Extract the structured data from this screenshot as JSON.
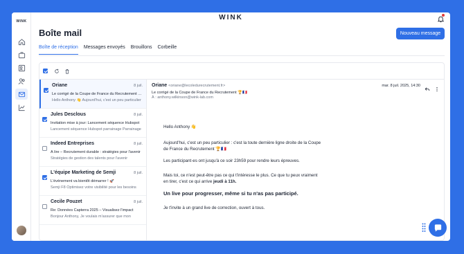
{
  "app": {
    "logo": "WINK",
    "side_logo": "WINK"
  },
  "header": {
    "title": "Boîte mail",
    "new_button": "Nouveau message"
  },
  "tabs": [
    {
      "label": "Boîte de réception",
      "active": true
    },
    {
      "label": "Messages envoyés",
      "active": false
    },
    {
      "label": "Brouillons",
      "active": false
    },
    {
      "label": "Corbeille",
      "active": false
    }
  ],
  "sidebar": {
    "items": [
      {
        "icon": "home-icon",
        "active": false
      },
      {
        "icon": "briefcase-icon",
        "active": false
      },
      {
        "icon": "contacts-icon",
        "active": false
      },
      {
        "icon": "users-icon",
        "active": false
      },
      {
        "icon": "mail-icon",
        "active": true
      },
      {
        "icon": "chart-icon",
        "active": false
      }
    ]
  },
  "emails": [
    {
      "sender": "Oriane",
      "date": "8 juil.",
      "subject": "Le corrigé de la Coupe de France du Recrutement 🏆🇫🇷",
      "preview": "Hello Anthony 👋 Aujourd'hui, c'est un peu particulier",
      "checked": true,
      "selected": true
    },
    {
      "sender": "Jules Desclous",
      "date": "8 juil.",
      "subject": "Invitation mise à jour: Lancement séquence Hubspot",
      "preview": "Lancement séquence Hubspot parrainage Parrainage",
      "checked": true,
      "selected": false
    },
    {
      "sender": "Indeed Entreprises",
      "date": "8 juil.",
      "subject": "À lire – Recrutement durable : stratégies pour l'avenir",
      "preview": "Stratégies de gestion des talents pour l'avenir",
      "checked": false,
      "selected": false
    },
    {
      "sender": "L'équipe Marketing de Semji",
      "date": "8 juil.",
      "subject": "L'événement va bientôt démarrer ! 🚀",
      "preview": "Semji F8 Optimisez votre visibilité pour les besoins",
      "checked": true,
      "selected": false
    },
    {
      "sender": "Cecile Pouzet",
      "date": "8 juil.",
      "subject": "Re: Données Capterra 2025 – Visualisez l'impact",
      "preview": "Bonjour Anthony, Je voulais m'assurer que mon",
      "checked": false,
      "selected": false
    }
  ],
  "reader": {
    "from_name": "Oriane",
    "from_email": "<oriane@lecoledurecrutement.fr>",
    "subject": "Le corrigé de la Coupe de France du Recrutement 🏆🇫🇷",
    "to": "À : anthony.wilkinson@wink-lab.com",
    "date": "mar. 8 juil. 2025, 14:30",
    "body": {
      "greeting": "Hello Anthony 👋",
      "p1": "Aujourd'hui, c'est un peu particulier : c'est la toute dernière ligne droite de la Coupe de France du Recrutement 🏆🇫🇷",
      "p2": "Les participant·es ont jusqu'à ce soir 23h59 pour rendre leurs épreuves.",
      "p3_start": "Mais toi, ce n'est peut-être pas ce qui t'intéresse le plus. Ce que tu peux vraiment en tirer, c'est ce qui arrive ",
      "p3_bold": "jeudi à 11h.",
      "heading": "Un live pour progresser, même si tu n'as pas participé.",
      "p4": "Je t'invite à un grand live de correction, ouvert à tous."
    }
  },
  "colors": {
    "accent": "#2f6fe6",
    "background": "#2f6fe6"
  }
}
